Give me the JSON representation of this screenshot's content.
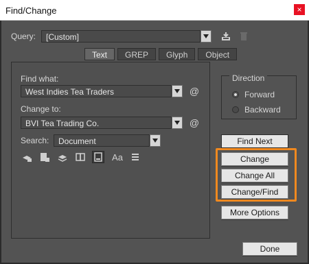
{
  "window": {
    "title": "Find/Change",
    "close_icon": "close-icon",
    "accent_close": "#e81123"
  },
  "query": {
    "label": "Query:",
    "value": "[Custom]",
    "icons": [
      "save-query-icon",
      "delete-query-icon"
    ]
  },
  "tabs": [
    {
      "label": "Text",
      "active": true
    },
    {
      "label": "GREP",
      "active": false
    },
    {
      "label": "Glyph",
      "active": false
    },
    {
      "label": "Object",
      "active": false
    }
  ],
  "find": {
    "label": "Find what:",
    "value": "West Indies Tea Traders",
    "special_icon": "at-special-characters-icon"
  },
  "change": {
    "label": "Change to:",
    "value": "BVI Tea Trading Co.",
    "special_icon": "at-special-characters-icon"
  },
  "search": {
    "label": "Search:",
    "value": "Document"
  },
  "search_options": [
    {
      "icon": "include-locked-layers-icon",
      "active": false
    },
    {
      "icon": "include-locked-stories-icon",
      "active": false
    },
    {
      "icon": "include-hidden-layers-icon",
      "active": false
    },
    {
      "icon": "include-master-pages-icon",
      "active": false
    },
    {
      "icon": "include-footnotes-icon",
      "active": true
    },
    {
      "icon": "case-sensitive-icon",
      "active": false
    },
    {
      "icon": "whole-word-icon",
      "active": false
    }
  ],
  "case_sensitive_label": "Aa",
  "direction": {
    "title": "Direction",
    "options": [
      {
        "label": "Forward",
        "selected": true
      },
      {
        "label": "Backward",
        "selected": false
      }
    ]
  },
  "buttons": {
    "find_next": "Find Next",
    "change": "Change",
    "change_all": "Change All",
    "change_find": "Change/Find",
    "more_options": "More Options",
    "done": "Done"
  },
  "colors": {
    "dialog_bg": "#535353",
    "highlight": "#f0891f"
  }
}
